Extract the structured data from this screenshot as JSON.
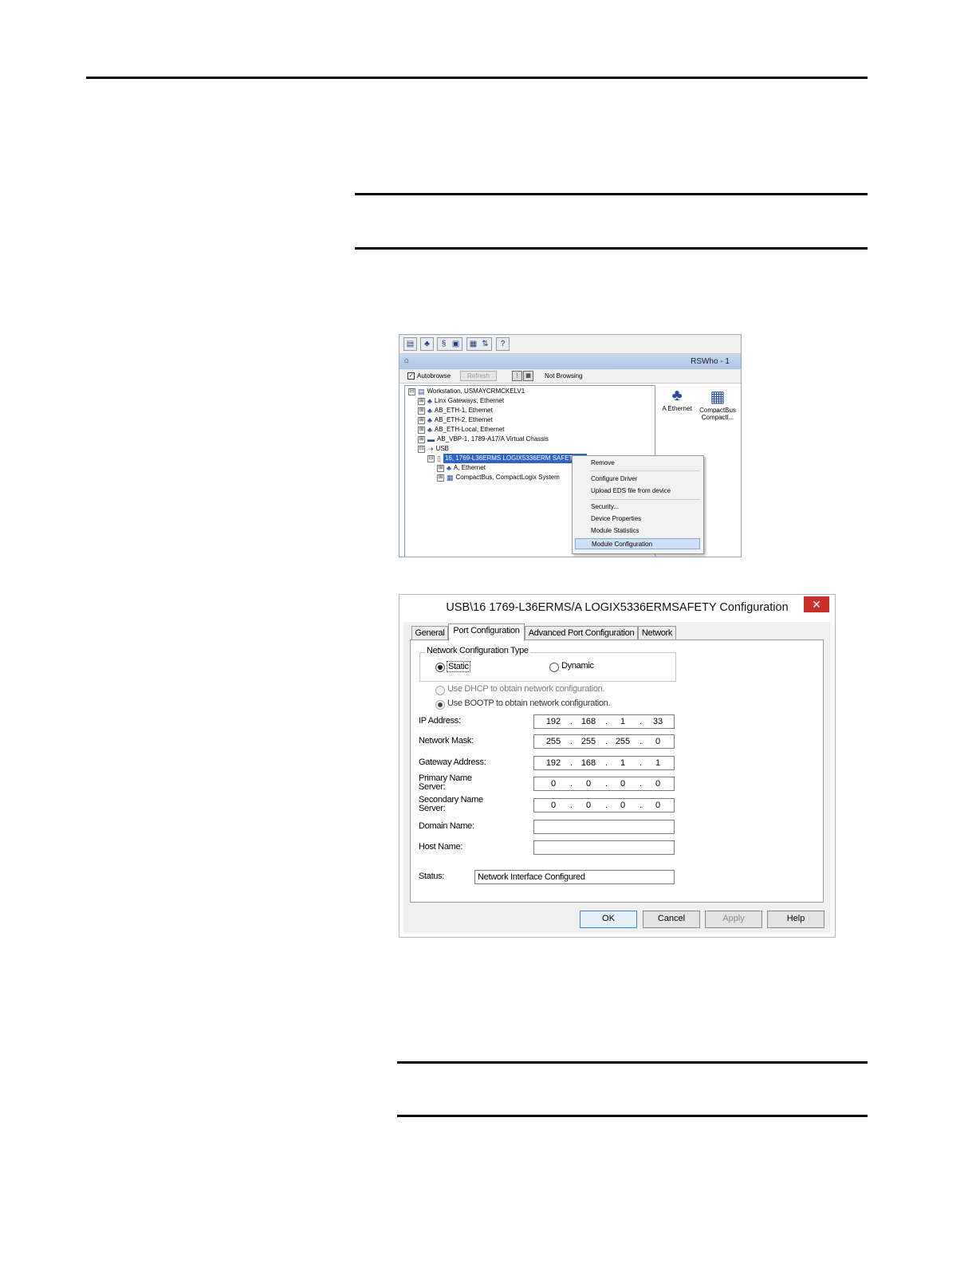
{
  "rswho": {
    "toolbar_icons": [
      "open-icon",
      "network-icon",
      "driver-icon",
      "module-icon",
      "upload-icon",
      "help-icon"
    ],
    "title": "RSWho - 1",
    "autobrowse_label": "Autobrowse",
    "refresh_label": "Refresh",
    "not_browsing": "Not Browsing",
    "tree": [
      {
        "label": "Workstation, USMAYCRMCKELV1",
        "pm": "⊟",
        "icon": "workstation-icon"
      },
      {
        "label": "Linx Gateways, Ethernet",
        "pm": "⊞",
        "icon": "network-icon"
      },
      {
        "label": "AB_ETH-1, Ethernet",
        "pm": "⊞",
        "icon": "network-icon"
      },
      {
        "label": "AB_ETH-2, Ethernet",
        "pm": "⊞",
        "icon": "network-icon"
      },
      {
        "label": "AB_ETH-Local, Ethernet",
        "pm": "⊞",
        "icon": "network-icon"
      },
      {
        "label": "AB_VBP-1, 1789-A17/A Virtual Chassis",
        "pm": "⊞",
        "icon": "chassis-icon"
      },
      {
        "label": "USB",
        "pm": "⊟",
        "icon": "usb-icon"
      },
      {
        "label": "16, 1769-L36ERMS LOGIX5336ERM SAFETY, ...",
        "pm": "⊟",
        "icon": "controller-icon"
      },
      {
        "label": "A, Ethernet",
        "pm": "⊞",
        "icon": "network-icon"
      },
      {
        "label": "CompactBus, CompactLogix System",
        "pm": "⊞",
        "icon": "backplane-icon"
      }
    ],
    "right_icons": [
      {
        "label": "A Ethernet",
        "icon": "ethernet-network-icon"
      },
      {
        "label": "CompactBus Compactl...",
        "icon": "compactbus-icon"
      }
    ],
    "context_menu": [
      "Remove",
      "Configure Driver",
      "Upload EDS file from device",
      "Security...",
      "Device Properties",
      "Module Statistics",
      "Module Configuration"
    ]
  },
  "dialog": {
    "title": "USB\\16 1769-L36ERMS/A LOGIX5336ERMSAFETY Configuration",
    "close": "✕",
    "tabs": [
      "General",
      "Port Configuration",
      "Advanced Port Configuration",
      "Network"
    ],
    "group_label": "Network Configuration Type",
    "static_label": "Static",
    "dynamic_label": "Dynamic",
    "dhcp_label": "Use DHCP to obtain network configuration.",
    "bootp_label": "Use BOOTP to obtain network configuration.",
    "fields": {
      "ip_label": "IP Address:",
      "ip": [
        "192",
        "168",
        "1",
        "33"
      ],
      "mask_label": "Network Mask:",
      "mask": [
        "255",
        "255",
        "255",
        "0"
      ],
      "gateway_label": "Gateway Address:",
      "gateway": [
        "192",
        "168",
        "1",
        "1"
      ],
      "primary_label": "Primary Name Server:",
      "primary": [
        "0",
        "0",
        "0",
        "0"
      ],
      "secondary_label": "Secondary Name Server:",
      "secondary": [
        "0",
        "0",
        "0",
        "0"
      ],
      "domain_label": "Domain Name:",
      "domain": "",
      "host_label": "Host Name:",
      "host": "",
      "status_label": "Status:",
      "status": "Network Interface Configured"
    },
    "buttons": {
      "ok": "OK",
      "cancel": "Cancel",
      "apply": "Apply",
      "help": "Help"
    }
  }
}
